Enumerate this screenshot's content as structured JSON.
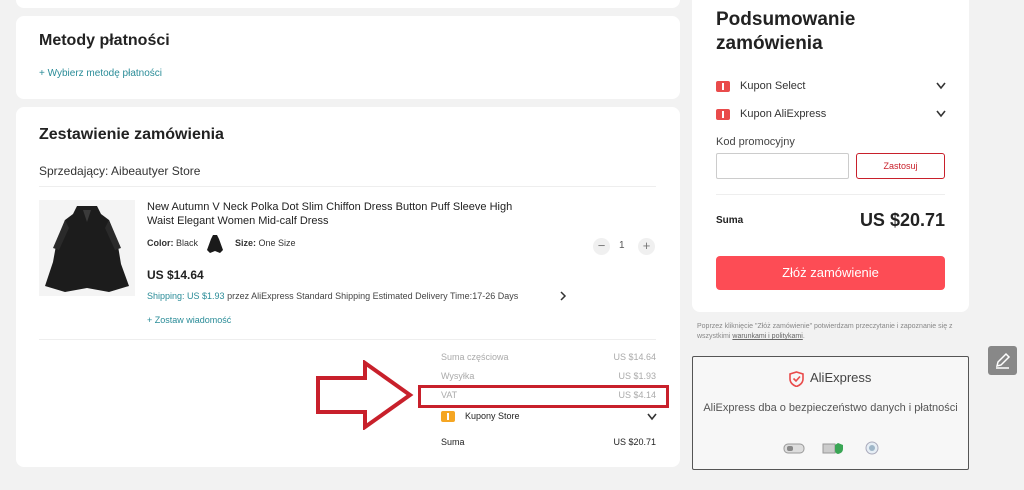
{
  "payment": {
    "title": "Metody płatności",
    "choose_link": "+ Wybierz metodę płatności"
  },
  "order": {
    "title": "Zestawienie zamówienia",
    "seller": "Sprzedający: Aibeautyer Store",
    "product": {
      "title": "New Autumn V Neck Polka Dot Slim Chiffon Dress Button Puff Sleeve High Waist Elegant Women Mid-calf Dress",
      "color_label": "Color:",
      "color_value": "Black",
      "size_label": "Size:",
      "size_value": "One Size",
      "price": "US $14.64",
      "shipping_label": "Shipping: US $1.93",
      "shipping_text": "przez AliExpress Standard Shipping Estimated Delivery Time:17-26 Days",
      "message_link": "+ Zostaw wiadomość",
      "quantity": "1",
      "minus": "−",
      "plus": "+"
    },
    "summary": {
      "subtotal_label": "Suma częściowa",
      "subtotal_value": "US $14.64",
      "shipping_label": "Wysyłka",
      "shipping_value": "US $1.93",
      "vat_label": "VAT",
      "vat_value": "US $4.14",
      "coupons_label": "Kupony Store",
      "total_label": "Suma",
      "total_value": "US $20.71"
    }
  },
  "sidebar": {
    "title": "Podsumowanie zamówienia",
    "coupon_select": "Kupon Select",
    "coupon_aliexpress": "Kupon AliExpress",
    "promo_label": "Kod promocyjny",
    "promo_placeholder": "",
    "apply_button": "Zastosuj",
    "total_label": "Suma",
    "total_value": "US $20.71",
    "order_button": "Złóż zamówienie"
  },
  "legal": {
    "text_before": "Poprzez kliknięcie \"Złóż zamówienie\" potwierdzam przeczytanie i zapoznanie się z wszystkimi ",
    "terms_link": "warunkami i politykami",
    "text_after": "."
  },
  "security": {
    "brand": "AliExpress",
    "text": "AliExpress dba o bezpieczeństwo danych i płatności"
  },
  "colors": {
    "accent_red": "#fd4c55",
    "border_red": "#c8202b",
    "link_teal": "#2a8c98",
    "coupon_orange": "#f5a623"
  },
  "icons": [
    "chevron-down-icon",
    "chevron-right-icon",
    "coupon-icon",
    "shield-icon",
    "edit-icon",
    "red-arrow-annotation"
  ]
}
